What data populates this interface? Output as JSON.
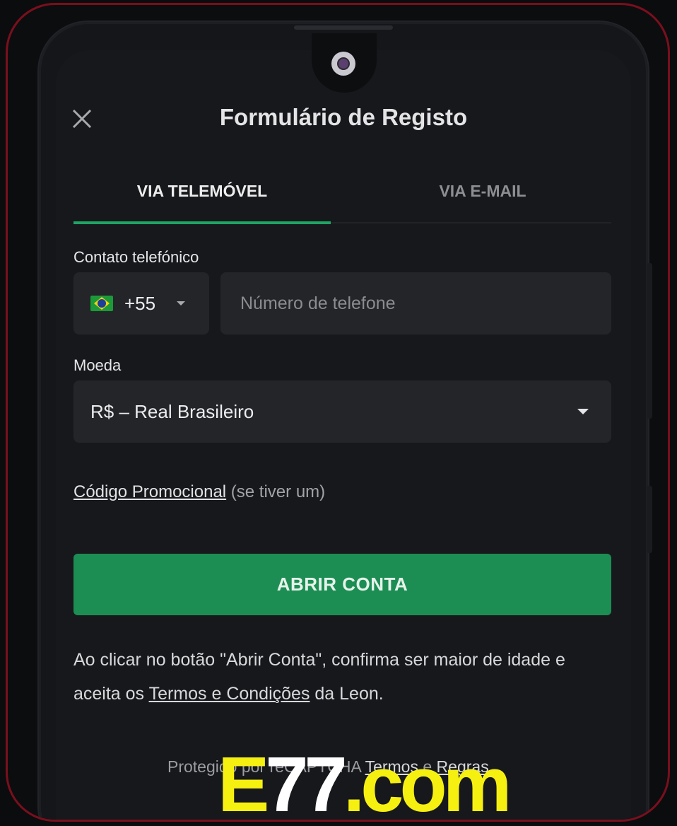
{
  "header": {
    "title": "Formulário de Registo",
    "close_icon": "close-icon"
  },
  "tabs": [
    {
      "label": "VIA TELEMÓVEL",
      "active": true
    },
    {
      "label": "VIA E-MAIL",
      "active": false
    }
  ],
  "phone": {
    "label": "Contato telefónico",
    "country_flag": "brazil-flag-icon",
    "dial_code": "+55",
    "placeholder": "Número de telefone",
    "value": ""
  },
  "currency": {
    "label": "Moeda",
    "selected": "R$ – Real Brasileiro"
  },
  "promo": {
    "link": "Código Promocional",
    "note": "(se tiver um)"
  },
  "submit": {
    "label": "ABRIR CONTA"
  },
  "consent": {
    "text_before": "Ao clicar no botão \"Abrir Conta\", confirma ser maior de idade e aceita os ",
    "terms_link": "Termos e Condições",
    "text_after": " da Leon."
  },
  "recaptcha": {
    "text": "Protegido por reCAPTCHA",
    "terms_link": "Termos",
    "and": "e",
    "rules_link": "Regras"
  },
  "watermark": {
    "part1": "E",
    "part2": "77",
    "part3": ".com"
  },
  "colors": {
    "accent_green": "#1c8e54",
    "tab_underline": "#1fa463",
    "frame_red": "#7a0f1d",
    "watermark_yellow": "#f6f011"
  }
}
